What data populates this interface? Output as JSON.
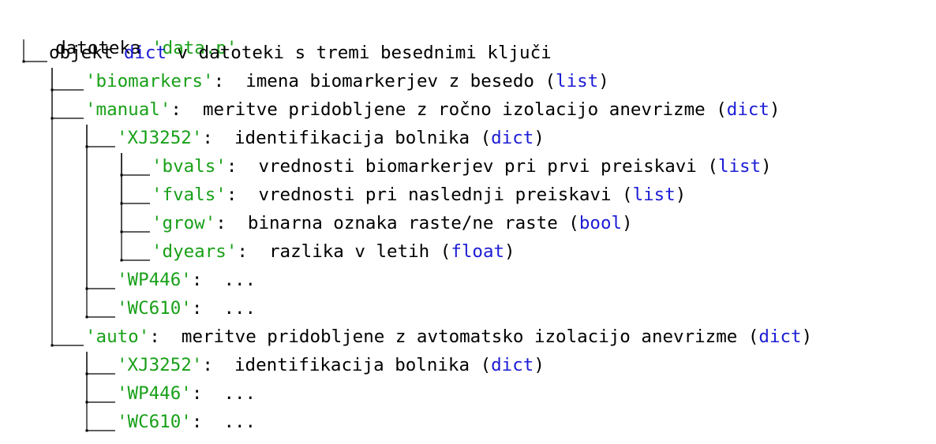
{
  "colors": {
    "text": "#000000",
    "key": "#18a018",
    "type": "#1c1cd6",
    "line": "#000000"
  },
  "tree": {
    "root": {
      "text": "datoteka ",
      "key": "'data.p'",
      "text2": "",
      "type": ""
    },
    "nodes": [
      {
        "level": 0,
        "text": "objekt ",
        "key": "",
        "type_inline": "dict",
        "text2": " v datoteki s tremi besednimi ključi",
        "type": ""
      },
      {
        "level": 1,
        "key": "'biomarkers'",
        "text": ":  imena biomarkerjev z besedo (",
        "type": "list",
        "close": ")"
      },
      {
        "level": 1,
        "key": "'manual'",
        "text": ":  meritve pridobljene z ročno izolacijo anevrizme (",
        "type": "dict",
        "close": ")"
      },
      {
        "level": 2,
        "key": "'XJ3252'",
        "text": ":  identifikacija bolnika (",
        "type": "dict",
        "close": ")"
      },
      {
        "level": 3,
        "key": "'bvals'",
        "text": ":  vrednosti biomarkerjev pri prvi preiskavi (",
        "type": "list",
        "close": ")"
      },
      {
        "level": 3,
        "key": "'fvals'",
        "text": ":  vrednosti pri naslednji preiskavi (",
        "type": "list",
        "close": ")"
      },
      {
        "level": 3,
        "key": "'grow'",
        "text": ":  binarna oznaka raste/ne raste (",
        "type": "bool",
        "close": ")"
      },
      {
        "level": 3,
        "key": "'dyears'",
        "text": ":  razlika v letih (",
        "type": "float",
        "close": ")"
      },
      {
        "level": 2,
        "key": "'WP446'",
        "text": ":  ...",
        "type": "",
        "close": ""
      },
      {
        "level": 2,
        "key": "'WC610'",
        "text": ":  ...",
        "type": "",
        "close": ""
      },
      {
        "level": 1,
        "key": "'auto'",
        "text": ":  meritve pridobljene z avtomatsko izolacijo anevrizme (",
        "type": "dict",
        "close": ")"
      },
      {
        "level": 2,
        "key": "'XJ3252'",
        "text": ":  identifikacija bolnika (",
        "type": "dict",
        "close": ")"
      },
      {
        "level": 2,
        "key": "'WP446'",
        "text": ":  ...",
        "type": "",
        "close": ""
      },
      {
        "level": 2,
        "key": "'WC610'",
        "text": ":  ...",
        "type": "",
        "close": ""
      }
    ]
  }
}
